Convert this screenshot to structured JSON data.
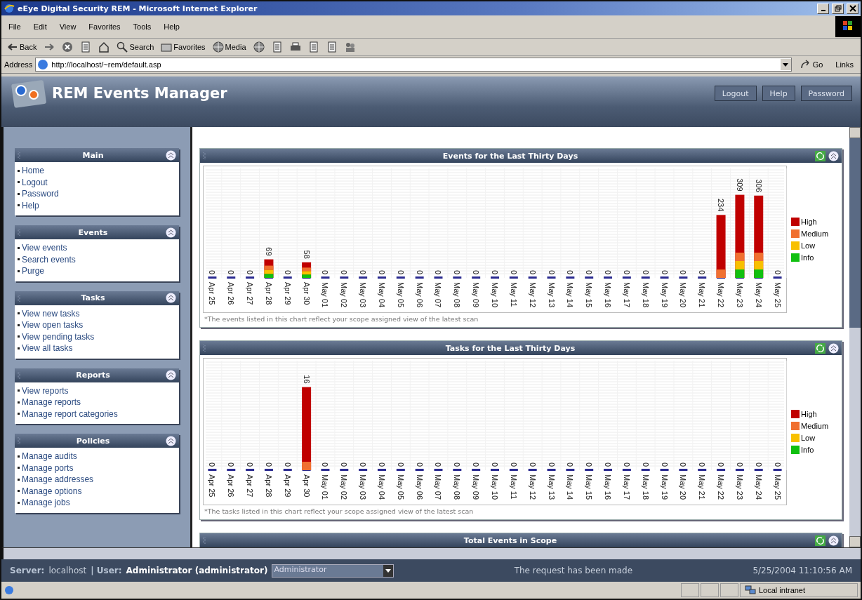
{
  "window": {
    "title": "eEye Digital Security REM - Microsoft Internet Explorer"
  },
  "menu": [
    "File",
    "Edit",
    "View",
    "Favorites",
    "Tools",
    "Help"
  ],
  "toolbar": [
    {
      "kind": "back",
      "label": "Back"
    },
    {
      "kind": "forward"
    },
    {
      "kind": "stop"
    },
    {
      "kind": "refresh"
    },
    {
      "kind": "home"
    },
    {
      "kind": "search",
      "label": "Search"
    },
    {
      "kind": "favorites",
      "label": "Favorites"
    },
    {
      "kind": "media",
      "label": "Media"
    },
    {
      "kind": "history"
    },
    {
      "kind": "mail"
    },
    {
      "kind": "print"
    },
    {
      "kind": "edit"
    },
    {
      "kind": "discuss"
    },
    {
      "kind": "messenger"
    }
  ],
  "address": {
    "label": "Address",
    "value": "http://localhost/~rem/default.asp",
    "go": "Go",
    "links": "Links"
  },
  "app": {
    "title": "REM Events Manager",
    "buttons": [
      "Logout",
      "Help",
      "Password"
    ]
  },
  "sidebar": [
    {
      "title": "Main",
      "items": [
        "Home",
        "Logout",
        "Password",
        "Help"
      ]
    },
    {
      "title": "Events",
      "items": [
        "View events",
        "Search events",
        "Purge"
      ]
    },
    {
      "title": "Tasks",
      "items": [
        "View new tasks",
        "View open tasks",
        "View pending tasks",
        "View all tasks"
      ]
    },
    {
      "title": "Reports",
      "items": [
        "View reports",
        "Manage reports",
        "Manage report categories"
      ]
    },
    {
      "title": "Policies",
      "items": [
        "Manage audits",
        "Manage ports",
        "Manage addresses",
        "Manage options",
        "Manage jobs"
      ]
    }
  ],
  "panels": [
    {
      "title": "Events for the Last Thirty Days",
      "note": "*The events listed in this chart reflect your scope assigned view of the latest scan",
      "chart_data": {
        "type": "bar",
        "data_labels": true,
        "categories": [
          "Apr 25",
          "Apr 26",
          "Apr 27",
          "Apr 28",
          "Apr 29",
          "Apr 30",
          "May 01",
          "May 02",
          "May 03",
          "May 04",
          "May 05",
          "May 06",
          "May 07",
          "May 08",
          "May 09",
          "May 10",
          "May 11",
          "May 12",
          "May 13",
          "May 14",
          "May 15",
          "May 16",
          "May 17",
          "May 18",
          "May 19",
          "May 20",
          "May 21",
          "May 22",
          "May 23",
          "May 24",
          "May 25"
        ],
        "values": [
          0,
          0,
          0,
          69,
          0,
          58,
          0,
          0,
          0,
          0,
          0,
          0,
          0,
          0,
          0,
          0,
          0,
          0,
          0,
          0,
          0,
          0,
          0,
          0,
          0,
          0,
          0,
          234,
          309,
          306,
          0
        ]
      },
      "bars": [
        {
          "kind": "empty"
        },
        {
          "kind": "empty"
        },
        {
          "kind": "empty"
        },
        {
          "kind": "stack",
          "segments": [
            {
              "color": "#c00000"
            },
            {
              "color": "#f07030"
            },
            {
              "color": "#f8c000"
            },
            {
              "color": "#10c010"
            }
          ]
        },
        {
          "kind": "empty"
        },
        {
          "kind": "stack",
          "segments": [
            {
              "color": "#c00000"
            },
            {
              "color": "#f07030"
            },
            {
              "color": "#f8c000"
            },
            {
              "color": "#10c010"
            }
          ]
        },
        {
          "kind": "empty"
        },
        {
          "kind": "empty"
        },
        {
          "kind": "empty"
        },
        {
          "kind": "empty"
        },
        {
          "kind": "empty"
        },
        {
          "kind": "empty"
        },
        {
          "kind": "empty"
        },
        {
          "kind": "empty"
        },
        {
          "kind": "empty"
        },
        {
          "kind": "empty"
        },
        {
          "kind": "empty"
        },
        {
          "kind": "empty"
        },
        {
          "kind": "empty"
        },
        {
          "kind": "empty"
        },
        {
          "kind": "empty"
        },
        {
          "kind": "empty"
        },
        {
          "kind": "empty"
        },
        {
          "kind": "empty"
        },
        {
          "kind": "empty"
        },
        {
          "kind": "empty"
        },
        {
          "kind": "empty"
        },
        {
          "kind": "stack",
          "segments": [
            {
              "color": "#c00000"
            },
            {
              "color": "#f07030"
            }
          ]
        },
        {
          "kind": "stack",
          "segments": [
            {
              "color": "#c00000"
            },
            {
              "color": "#f07030"
            },
            {
              "color": "#f8c000"
            },
            {
              "color": "#10c010"
            }
          ]
        },
        {
          "kind": "stack",
          "segments": [
            {
              "color": "#c00000"
            },
            {
              "color": "#f07030"
            },
            {
              "color": "#f8c000"
            },
            {
              "color": "#10c010"
            }
          ]
        },
        {
          "kind": "empty"
        }
      ],
      "legend": [
        {
          "name": "High",
          "color": "#c00000"
        },
        {
          "name": "Medium",
          "color": "#f07030"
        },
        {
          "name": "Low",
          "color": "#f8c000"
        },
        {
          "name": "Info",
          "color": "#10c010"
        }
      ]
    },
    {
      "title": "Tasks for the Last Thirty Days",
      "note": "*The tasks listed in this chart reflect your scope assigned view of the latest scan",
      "chart_data": {
        "type": "bar",
        "data_labels": true,
        "categories": [
          "Apr 25",
          "Apr 26",
          "Apr 27",
          "Apr 28",
          "Apr 29",
          "Apr 30",
          "May 01",
          "May 02",
          "May 03",
          "May 04",
          "May 05",
          "May 06",
          "May 07",
          "May 08",
          "May 09",
          "May 10",
          "May 11",
          "May 12",
          "May 13",
          "May 14",
          "May 15",
          "May 16",
          "May 17",
          "May 18",
          "May 19",
          "May 20",
          "May 21",
          "May 22",
          "May 23",
          "May 24",
          "May 25"
        ],
        "values": [
          0,
          0,
          0,
          0,
          0,
          16,
          0,
          0,
          0,
          0,
          0,
          0,
          0,
          0,
          0,
          0,
          0,
          0,
          0,
          0,
          0,
          0,
          0,
          0,
          0,
          0,
          0,
          0,
          0,
          0,
          0
        ]
      },
      "bars": [
        {
          "kind": "empty"
        },
        {
          "kind": "empty"
        },
        {
          "kind": "empty"
        },
        {
          "kind": "empty"
        },
        {
          "kind": "empty"
        },
        {
          "kind": "stack",
          "segments": [
            {
              "color": "#c00000"
            },
            {
              "color": "#f07030"
            }
          ]
        },
        {
          "kind": "empty"
        },
        {
          "kind": "empty"
        },
        {
          "kind": "empty"
        },
        {
          "kind": "empty"
        },
        {
          "kind": "empty"
        },
        {
          "kind": "empty"
        },
        {
          "kind": "empty"
        },
        {
          "kind": "empty"
        },
        {
          "kind": "empty"
        },
        {
          "kind": "empty"
        },
        {
          "kind": "empty"
        },
        {
          "kind": "empty"
        },
        {
          "kind": "empty"
        },
        {
          "kind": "empty"
        },
        {
          "kind": "empty"
        },
        {
          "kind": "empty"
        },
        {
          "kind": "empty"
        },
        {
          "kind": "empty"
        },
        {
          "kind": "empty"
        },
        {
          "kind": "empty"
        },
        {
          "kind": "empty"
        },
        {
          "kind": "empty"
        },
        {
          "kind": "empty"
        },
        {
          "kind": "empty"
        },
        {
          "kind": "empty"
        }
      ],
      "legend": [
        {
          "name": "High",
          "color": "#c00000"
        },
        {
          "name": "Medium",
          "color": "#f07030"
        },
        {
          "name": "Low",
          "color": "#f8c000"
        },
        {
          "name": "Info",
          "color": "#10c010"
        }
      ]
    },
    {
      "title": "Total Events in Scope"
    }
  ],
  "footer": {
    "server_label": "Server:",
    "server": "localhost",
    "user_label": "| User:",
    "user": "Administrator (administrator)",
    "role": "Administrator",
    "message": "The request has been made",
    "datetime": "5/25/2004 11:10:56 AM"
  },
  "status_bar": {
    "zone": "Local intranet"
  }
}
